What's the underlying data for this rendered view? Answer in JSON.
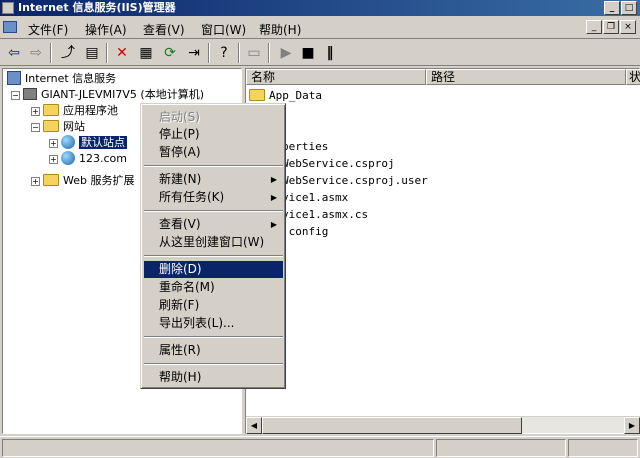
{
  "window": {
    "title": "Internet 信息服务(IIS)管理器"
  },
  "menubar": {
    "items": [
      "文件(F)",
      "操作(A)",
      "查看(V)",
      "窗口(W)",
      "帮助(H)"
    ]
  },
  "tree": {
    "root": "Internet 信息服务",
    "computer": "GIANT-JLEVMI7V5 (本地计算机)",
    "app_pools": "应用程序池",
    "websites": "网站",
    "default_site": "默认站点",
    "site_123": "123.com",
    "web_ext": "Web 服务扩展"
  },
  "list": {
    "columns": [
      "名称",
      "路径",
      "状"
    ],
    "rows": [
      "App_Data",
      "perties",
      "WebService.csproj",
      "WebService.csproj.user",
      "vice1.asmx",
      "vice1.asmx.cs",
      ".config"
    ]
  },
  "context_menu": {
    "start": "启动(S)",
    "stop": "停止(P)",
    "pause": "暂停(A)",
    "new": "新建(N)",
    "all_tasks": "所有任务(K)",
    "view": "查看(V)",
    "new_window": "从这里创建窗口(W)",
    "delete": "删除(D)",
    "rename": "重命名(M)",
    "refresh": "刷新(F)",
    "export": "导出列表(L)...",
    "properties": "属性(R)",
    "help": "帮助(H)"
  },
  "colors": {
    "titlebar": "#0a246a",
    "highlight": "#0a246a",
    "chrome": "#d4d0c8"
  }
}
